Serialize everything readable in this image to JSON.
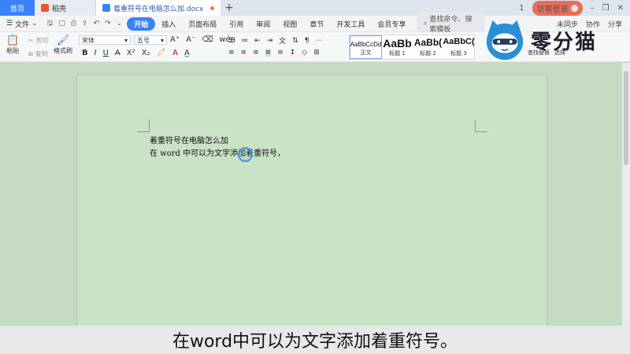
{
  "tabs": {
    "home": "首页",
    "app": "稻壳",
    "doc": "着重符号在电脑怎么加.docx",
    "add": "+"
  },
  "window": {
    "login": "访客登录",
    "page_count": "1",
    "minimize": "–",
    "restore": "❐",
    "close": "✕"
  },
  "menu": {
    "file": "文件",
    "items": [
      "开始",
      "插入",
      "页面布局",
      "引用",
      "审阅",
      "视图",
      "章节",
      "开发工具",
      "会员专享"
    ],
    "search_placeholder": "查找命令、搜索模板",
    "sync": "未同步",
    "collab": "协作",
    "share": "分享"
  },
  "ribbon": {
    "paste": "粘贴",
    "cut": "剪切",
    "copy": "复制",
    "format_painter": "格式刷",
    "font_name": "宋体",
    "font_size": "五号",
    "find_replace": "查找替换",
    "select": "选择"
  },
  "styles": [
    {
      "preview": "AaBbCcDd",
      "name": "正文"
    },
    {
      "preview": "AaBb",
      "name": "标题 1"
    },
    {
      "preview": "AaBb(",
      "name": "标题 2"
    },
    {
      "preview": "AaBbC(",
      "name": "标题 3"
    }
  ],
  "logo": {
    "text": "零分猫"
  },
  "document": {
    "line1": "着重符号在电脑怎么加",
    "line2": "在 word 中可以为文字添加着重符号，"
  },
  "subtitle": "在word中可以为文字添加着重符号。",
  "colors": {
    "accent": "#3a82f7",
    "page": "#cae2c6",
    "login": "#e86d5c"
  }
}
